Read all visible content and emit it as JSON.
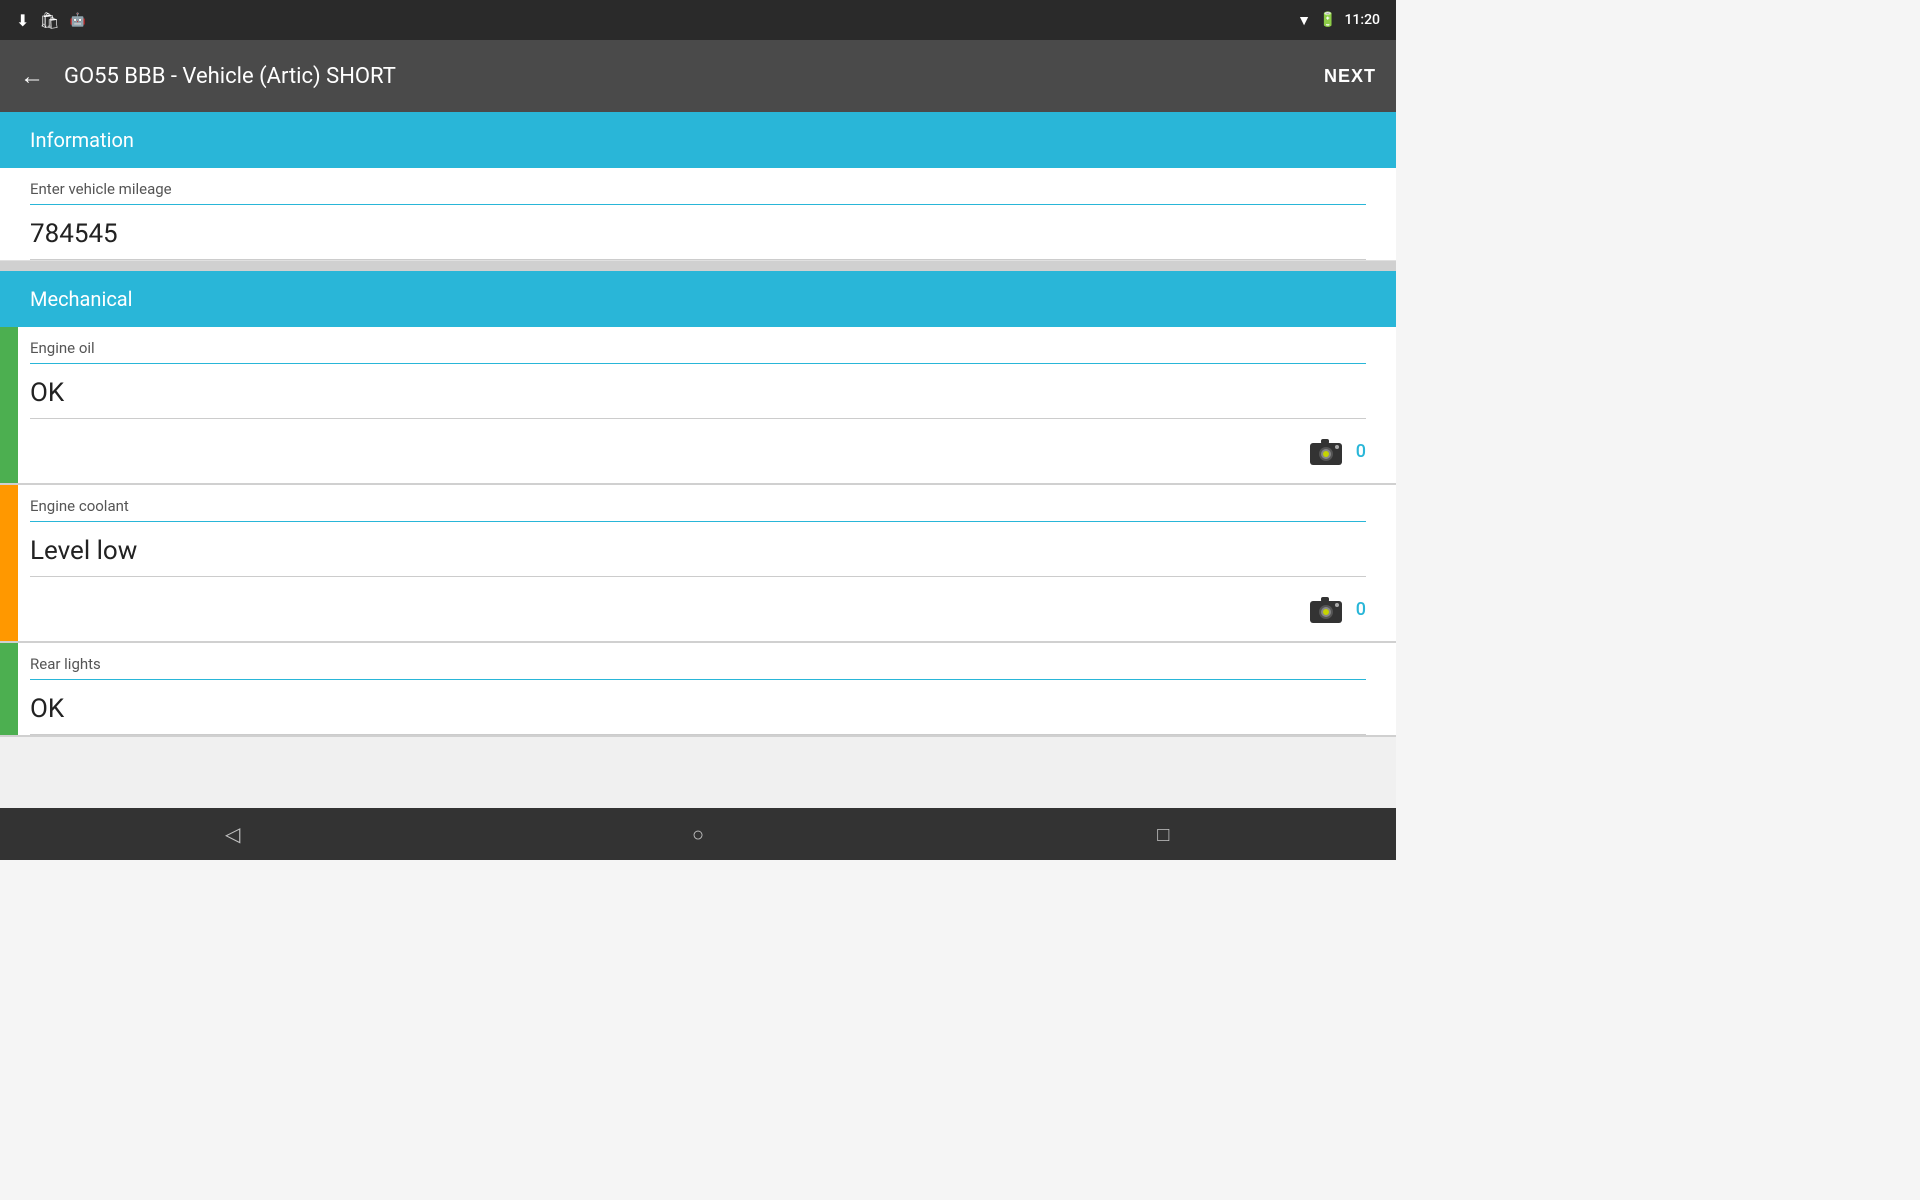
{
  "statusBar": {
    "time": "11:20",
    "icons": [
      "download-icon",
      "shopping-icon",
      "dev-icon",
      "wifi-icon",
      "battery-icon"
    ]
  },
  "appBar": {
    "backLabel": "←",
    "title": "GO55 BBB - Vehicle (Artic) SHORT",
    "nextLabel": "NEXT"
  },
  "sections": [
    {
      "id": "information",
      "label": "Information",
      "fields": [
        {
          "id": "vehicle-mileage",
          "label": "Enter vehicle mileage",
          "value": "784545",
          "hasCamera": false,
          "statusColor": null,
          "cameraCount": null
        }
      ]
    },
    {
      "id": "mechanical",
      "label": "Mechanical",
      "fields": [
        {
          "id": "engine-oil",
          "label": "Engine oil",
          "value": "OK",
          "hasCamera": true,
          "statusColor": "green",
          "cameraCount": "0"
        },
        {
          "id": "engine-coolant",
          "label": "Engine coolant",
          "value": "Level low",
          "hasCamera": true,
          "statusColor": "orange",
          "cameraCount": "0"
        },
        {
          "id": "rear-lights",
          "label": "Rear lights",
          "value": "OK",
          "hasCamera": false,
          "statusColor": "green",
          "cameraCount": null
        }
      ]
    }
  ],
  "bottomNav": {
    "backLabel": "◁",
    "homeLabel": "○",
    "recentLabel": "□"
  }
}
